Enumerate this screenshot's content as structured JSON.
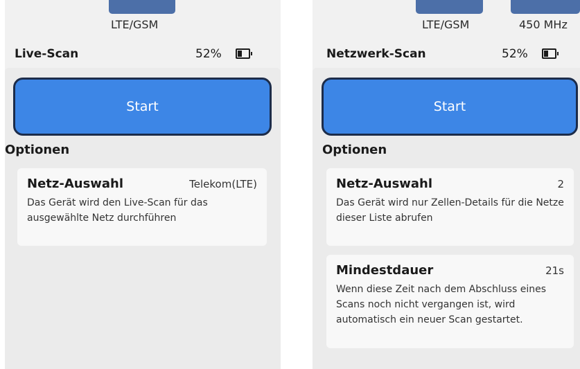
{
  "left": {
    "tabs": [
      "LTE/GSM"
    ],
    "title": "Live-Scan",
    "battery": "52%",
    "start_label": "Start",
    "section": "Optionen",
    "options": [
      {
        "title": "Netz-Auswahl",
        "value": "Telekom(LTE)",
        "desc": "Das Gerät wird den Live-Scan für das ausgewählte Netz durchführen"
      }
    ]
  },
  "right": {
    "tabs": [
      "LTE/GSM",
      "450 MHz"
    ],
    "title": "Netzwerk-Scan",
    "battery": "52%",
    "start_label": "Start",
    "section": "Optionen",
    "options": [
      {
        "title": "Netz-Auswahl",
        "value": "2",
        "desc": "Das Gerät wird nur Zellen-Details für die Netze dieser Liste abrufen"
      },
      {
        "title": "Mindestdauer",
        "value": "21s",
        "desc": "Wenn diese Zeit nach dem Abschluss eines Scans noch nicht vergangen ist, wird automatisch ein neuer Scan gestartet."
      }
    ]
  }
}
